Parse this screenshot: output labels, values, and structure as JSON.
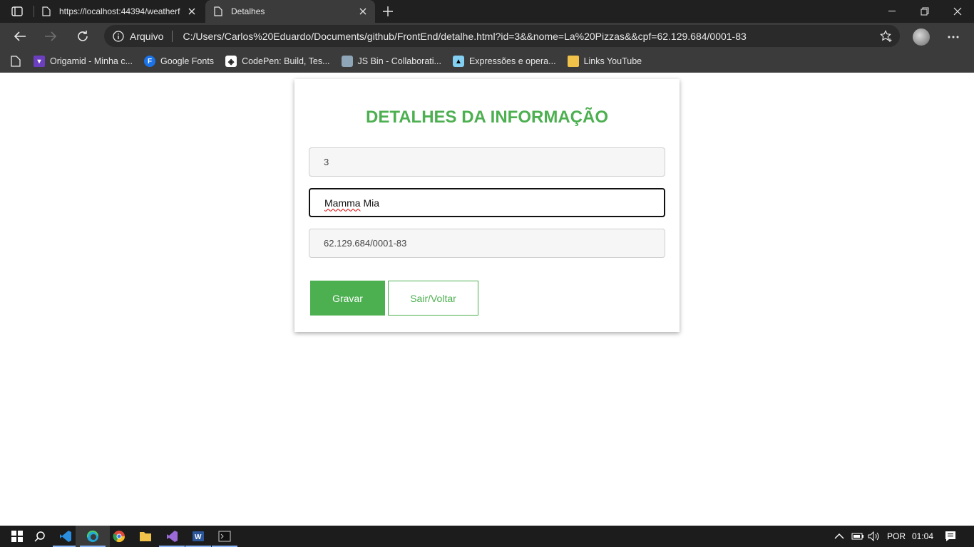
{
  "browser": {
    "tabs": [
      {
        "title": "https://localhost:44394/weatherf",
        "active": false
      },
      {
        "title": "Detalhes",
        "active": true
      }
    ],
    "address": {
      "scheme_label": "Arquivo",
      "url": "C:/Users/Carlos%20Eduardo/Documents/github/FrontEnd/detalhe.html?id=3&&nome=La%20Pizzas&&cpf=62.129.684/0001-83"
    },
    "bookmarks": [
      {
        "label": "Origamid - Minha c...",
        "icon": "origamid-icon",
        "color": "#6b3fbf"
      },
      {
        "label": "Google Fonts",
        "icon": "google-fonts-icon",
        "color": "#1a73e8"
      },
      {
        "label": "CodePen: Build, Tes...",
        "icon": "codepen-icon",
        "color": "#ffffff"
      },
      {
        "label": "JS Bin - Collaborati...",
        "icon": "jsbin-icon",
        "color": "#aabbcc"
      },
      {
        "label": "Expressões e opera...",
        "icon": "mdn-icon",
        "color": "#83d0f2"
      },
      {
        "label": "Links YouTube",
        "icon": "folder-icon",
        "color": "#f0c24a"
      }
    ]
  },
  "page": {
    "heading": "DETALHES DA INFORMAÇÃO",
    "fields": {
      "id_value": "3",
      "name_value": "Mamma Mia",
      "name_word1": "Mamma",
      "name_word2": " Mia",
      "cpf_value": "62.129.684/0001-83"
    },
    "buttons": {
      "save": "Gravar",
      "back": "Sair/Voltar"
    },
    "accent_color": "#4caf50"
  },
  "taskbar": {
    "language": "POR",
    "time": "01:04"
  }
}
